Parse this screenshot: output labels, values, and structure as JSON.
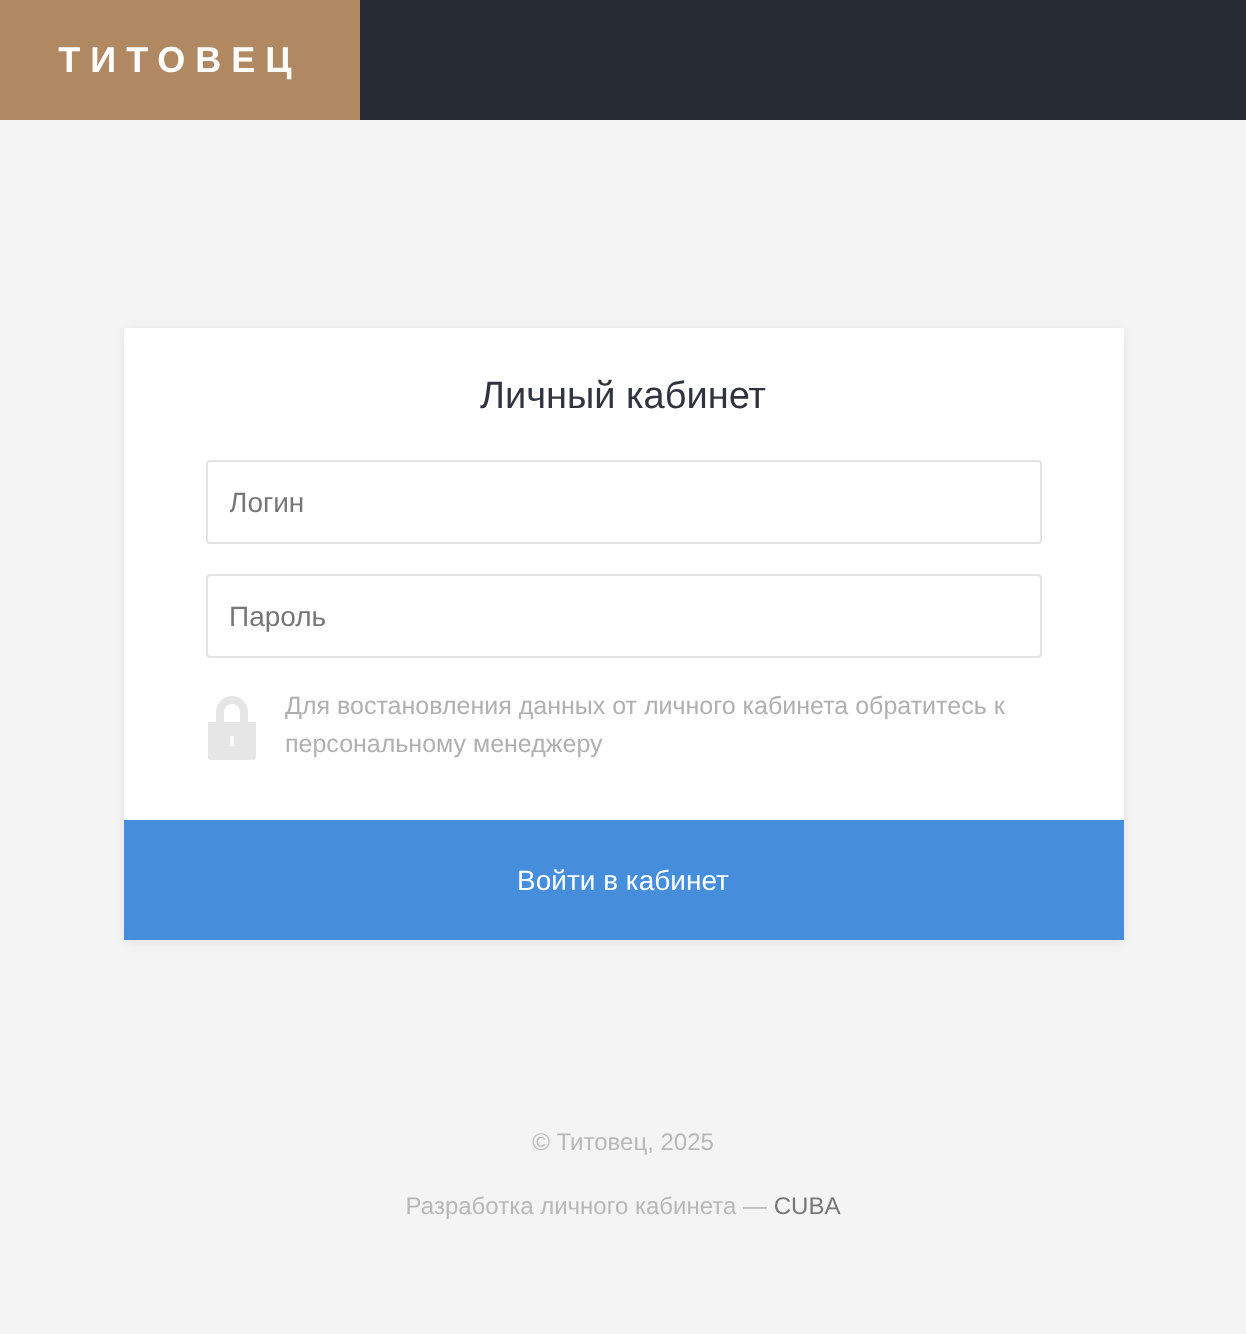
{
  "header": {
    "logo": "ТИТОВЕЦ"
  },
  "login_card": {
    "title": "Личный кабинет",
    "fields": [
      {
        "placeholder": "Логин"
      },
      {
        "placeholder": "Пароль"
      }
    ],
    "hint": "Для востановления данных от личного кабинета обратитесь к персональному менеджеру",
    "submit": "Войти в кабинет"
  },
  "footer": {
    "copyright": "© Титовец, 2025",
    "credit": "Разработка личного кабинета —",
    "credit_link": "CUBA"
  }
}
